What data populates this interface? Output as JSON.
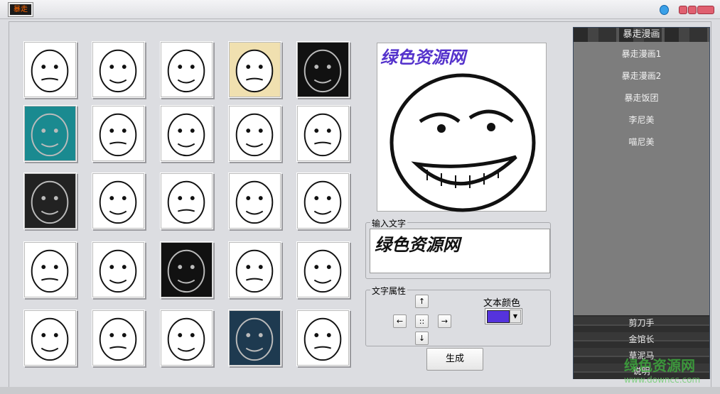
{
  "window": {
    "app_icon_text": "暴走"
  },
  "text_input": {
    "label": "输入文字",
    "value": "绿色资源网"
  },
  "preview": {
    "overlay_text": "绿色资源网"
  },
  "text_props": {
    "label": "文字属性",
    "up": "↑",
    "down": "↓",
    "left": "←",
    "right": "→",
    "center": "::",
    "color_label": "文本颜色",
    "color": "#5533dd",
    "dropdown": "▼"
  },
  "generate_label": "生成",
  "right_panel": {
    "header": "暴走漫画",
    "items": [
      "暴走漫画1",
      "暴走漫画2",
      "暴走饭团",
      "李尼美",
      "喵尼美"
    ],
    "bottom_items": [
      "剪刀手",
      "金馆长",
      "草泥马",
      "说明"
    ]
  },
  "watermark": {
    "text": "绿色资源网",
    "url": "www.downcc.com"
  },
  "thumbs": [
    {
      "bg": "#ffffff"
    },
    {
      "bg": "#ffffff"
    },
    {
      "bg": "#ffffff"
    },
    {
      "bg": "#f0e0b0"
    },
    {
      "bg": "#111111"
    },
    {
      "bg": "#1a8a90"
    },
    {
      "bg": "#ffffff"
    },
    {
      "bg": "#ffffff"
    },
    {
      "bg": "#ffffff"
    },
    {
      "bg": "#ffffff"
    },
    {
      "bg": "#222222"
    },
    {
      "bg": "#ffffff"
    },
    {
      "bg": "#ffffff"
    },
    {
      "bg": "#ffffff"
    },
    {
      "bg": "#ffffff"
    },
    {
      "bg": "#ffffff"
    },
    {
      "bg": "#ffffff"
    },
    {
      "bg": "#111111"
    },
    {
      "bg": "#ffffff"
    },
    {
      "bg": "#ffffff"
    },
    {
      "bg": "#ffffff"
    },
    {
      "bg": "#ffffff"
    },
    {
      "bg": "#ffffff"
    },
    {
      "bg": "#1e3a50"
    },
    {
      "bg": "#ffffff"
    }
  ]
}
